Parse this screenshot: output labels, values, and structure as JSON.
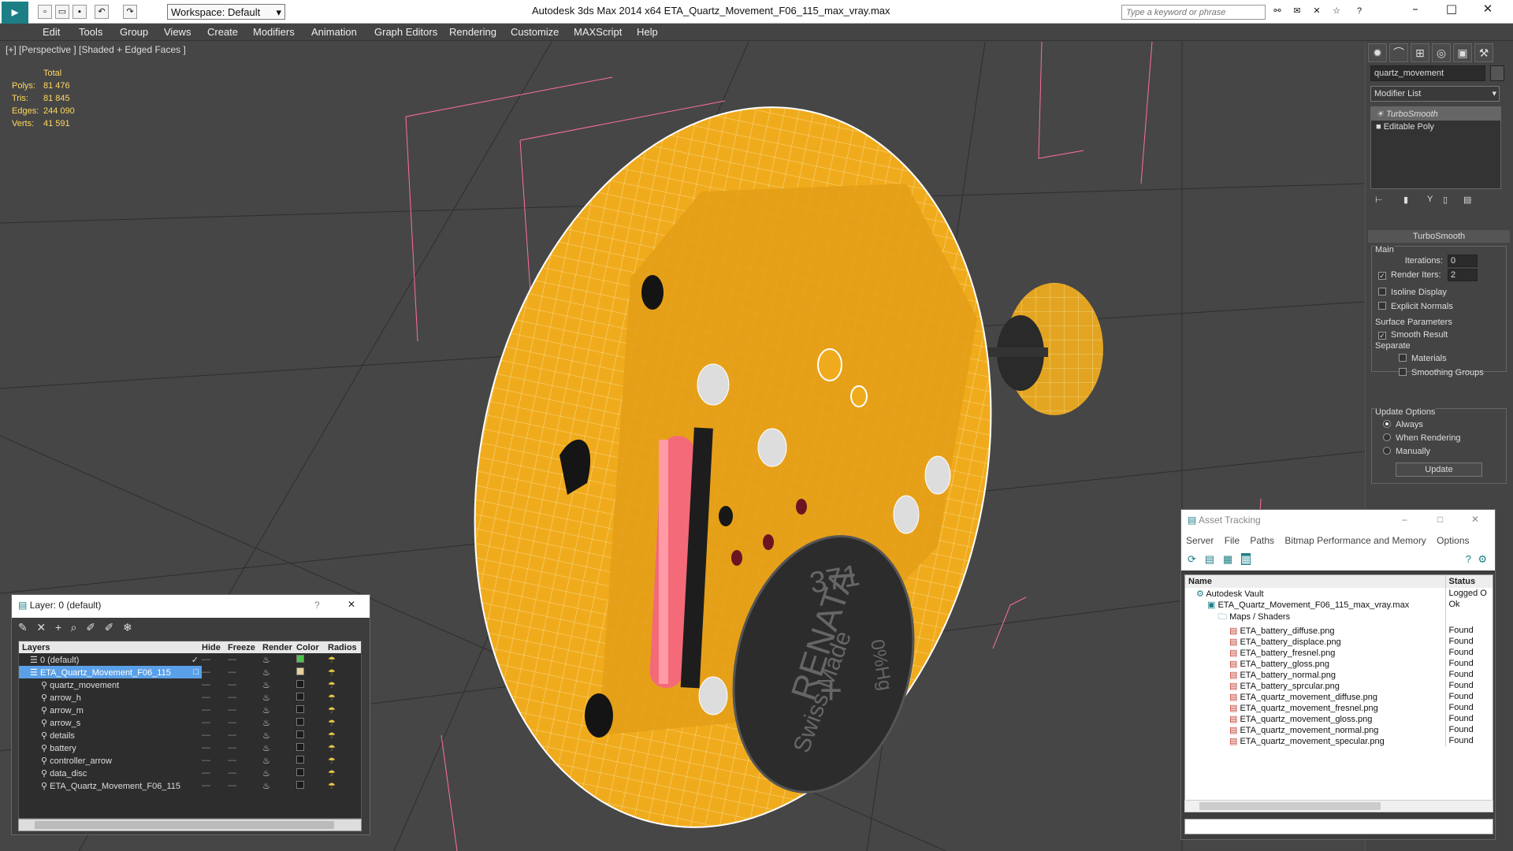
{
  "title_bar": {
    "workspace": "Workspace: Default",
    "app_title": "Autodesk 3ds Max  2014 x64      ETA_Quartz_Movement_F06_115_max_vray.max",
    "search_placeholder": "Type a keyword or phrase"
  },
  "menus": [
    "Edit",
    "Tools",
    "Group",
    "Views",
    "Create",
    "Modifiers",
    "Animation",
    "Graph Editors",
    "Rendering",
    "Customize",
    "MAXScript",
    "Help"
  ],
  "viewport": {
    "label": "[+] [Perspective ] [Shaded + Edged Faces ]",
    "stats": {
      "header": "Total",
      "rows": [
        {
          "k": "Polys:",
          "v": "81 476"
        },
        {
          "k": "Tris:",
          "v": "81 845"
        },
        {
          "k": "Edges:",
          "v": "244 090"
        },
        {
          "k": "Verts:",
          "v": "41 591"
        }
      ]
    },
    "battery_text": [
      "371",
      "RENATA",
      "+",
      "Swiss Made",
      "0%Hg"
    ]
  },
  "command_panel": {
    "object_name": "quartz_movement",
    "modifier_list": "Modifier List",
    "stack": [
      "TurboSmooth",
      "Editable Poly"
    ],
    "turbosmooth": {
      "title": "TurboSmooth",
      "main": "Main",
      "iterations_label": "Iterations:",
      "iterations_value": "0",
      "render_iters_label": "Render Iters:",
      "render_iters_value": "2",
      "isoline": "Isoline Display",
      "explicit": "Explicit Normals",
      "surface": "Surface Parameters",
      "smooth_result": "Smooth Result",
      "separate": "Separate",
      "materials": "Materials",
      "smoothing_groups": "Smoothing Groups",
      "update_options": "Update Options",
      "always": "Always",
      "when_rendering": "When Rendering",
      "manually": "Manually",
      "update": "Update"
    }
  },
  "layer_panel": {
    "title": "Layer: 0 (default)",
    "help": "?",
    "columns": [
      "Layers",
      "Hide",
      "Freeze",
      "Render",
      "Color",
      "Radios"
    ],
    "rows": [
      {
        "name": "0 (default)",
        "indent": 1,
        "color": "#4ec34e",
        "checked": true
      },
      {
        "name": "ETA_Quartz_Movement_F06_115",
        "indent": 1,
        "color": "#e7d39a",
        "selected": true
      },
      {
        "name": "quartz_movement",
        "indent": 2,
        "color": "#1a1a1a"
      },
      {
        "name": "arrow_h",
        "indent": 2,
        "color": "#1a1a1a"
      },
      {
        "name": "arrow_m",
        "indent": 2,
        "color": "#1a1a1a"
      },
      {
        "name": "arrow_s",
        "indent": 2,
        "color": "#1a1a1a"
      },
      {
        "name": "details",
        "indent": 2,
        "color": "#1a1a1a"
      },
      {
        "name": "battery",
        "indent": 2,
        "color": "#1a1a1a"
      },
      {
        "name": "controller_arrow",
        "indent": 2,
        "color": "#1a1a1a"
      },
      {
        "name": "data_disc",
        "indent": 2,
        "color": "#1a1a1a"
      },
      {
        "name": "ETA_Quartz_Movement_F06_115",
        "indent": 2,
        "color": "#1a1a1a"
      }
    ]
  },
  "asset_panel": {
    "title": "Asset Tracking",
    "menus": [
      "Server",
      "File",
      "Paths",
      "Bitmap Performance and Memory",
      "Options"
    ],
    "col_name": "Name",
    "col_status": "Status",
    "rows": [
      {
        "name": "Autodesk Vault",
        "status": "Logged O",
        "indent": 1,
        "type": "vault"
      },
      {
        "name": "ETA_Quartz_Movement_F06_115_max_vray.max",
        "status": "Ok",
        "indent": 2,
        "type": "max"
      },
      {
        "name": "Maps / Shaders",
        "status": "",
        "indent": 3,
        "type": "folder"
      },
      {
        "name": "ETA_battery_diffuse.png",
        "status": "Found",
        "indent": 4,
        "type": "png"
      },
      {
        "name": "ETA_battery_displace.png",
        "status": "Found",
        "indent": 4,
        "type": "png"
      },
      {
        "name": "ETA_battery_fresnel.png",
        "status": "Found",
        "indent": 4,
        "type": "png"
      },
      {
        "name": "ETA_battery_gloss.png",
        "status": "Found",
        "indent": 4,
        "type": "png"
      },
      {
        "name": "ETA_battery_normal.png",
        "status": "Found",
        "indent": 4,
        "type": "png"
      },
      {
        "name": "ETA_battery_sprcular.png",
        "status": "Found",
        "indent": 4,
        "type": "png"
      },
      {
        "name": "ETA_quartz_movement_diffuse.png",
        "status": "Found",
        "indent": 4,
        "type": "png"
      },
      {
        "name": "ETA_quartz_movement_fresnel.png",
        "status": "Found",
        "indent": 4,
        "type": "png"
      },
      {
        "name": "ETA_quartz_movement_gloss.png",
        "status": "Found",
        "indent": 4,
        "type": "png"
      },
      {
        "name": "ETA_quartz_movement_normal.png",
        "status": "Found",
        "indent": 4,
        "type": "png"
      },
      {
        "name": "ETA_quartz_movement_specular.png",
        "status": "Found",
        "indent": 4,
        "type": "png"
      }
    ]
  }
}
